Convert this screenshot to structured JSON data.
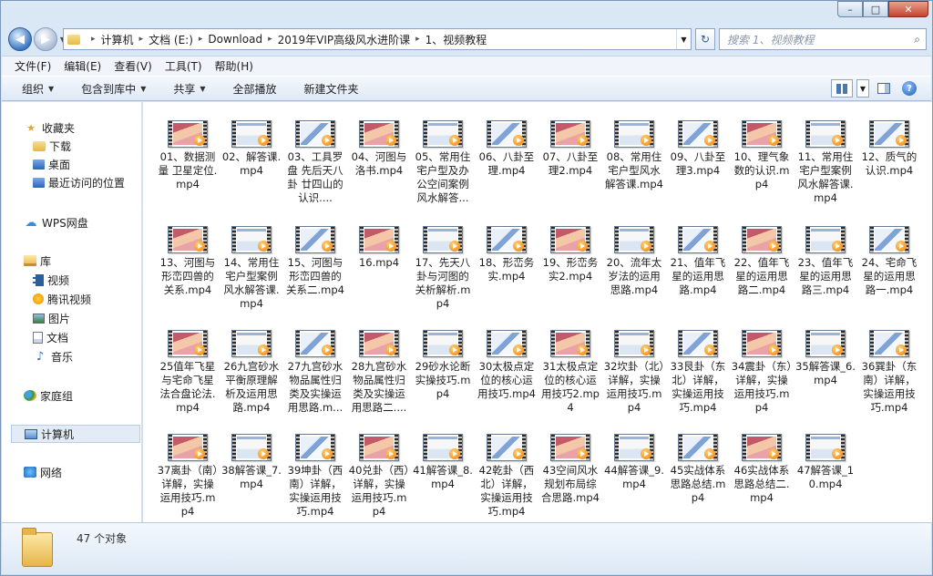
{
  "window": {
    "minimize_glyph": "–",
    "maximize_glyph": "□",
    "close_glyph": "✕"
  },
  "nav": {
    "back_glyph": "◀",
    "forward_glyph": "▶",
    "dropdown_glyph": "▼",
    "refresh_glyph": "↻"
  },
  "address": {
    "crumbs": [
      "计算机",
      "文档 (E:)",
      "Download",
      "2019年VIP高级风水进阶课",
      "1、视频教程"
    ],
    "separator": "▸"
  },
  "search": {
    "placeholder": "搜索 1、视频教程",
    "icon": "search-icon",
    "icon_glyph": "⌕"
  },
  "menu": {
    "items": [
      "文件(F)",
      "编辑(E)",
      "查看(V)",
      "工具(T)",
      "帮助(H)"
    ]
  },
  "toolbar": {
    "organize": "组织",
    "include_library": "包含到库中",
    "share": "共享",
    "play_all": "全部播放",
    "new_folder": "新建文件夹",
    "dropdown_glyph": "▼",
    "help_glyph": "?"
  },
  "sidebar": {
    "items": [
      {
        "label": "收藏夹",
        "icon": "star-icon",
        "glyph": "★"
      },
      {
        "label": "下载",
        "icon": "folder-icon",
        "glyph": ""
      },
      {
        "label": "桌面",
        "icon": "desktop-icon",
        "glyph": ""
      },
      {
        "label": "最近访问的位置",
        "icon": "recent-places-icon",
        "glyph": ""
      },
      {
        "label": "WPS网盘",
        "icon": "cloud-icon",
        "glyph": "☁"
      },
      {
        "label": "库",
        "icon": "library-icon",
        "glyph": ""
      },
      {
        "label": "视频",
        "icon": "video-library-icon",
        "glyph": ""
      },
      {
        "label": "腾讯视频",
        "icon": "tencent-video-icon",
        "glyph": ""
      },
      {
        "label": "图片",
        "icon": "pictures-icon",
        "glyph": ""
      },
      {
        "label": "文档",
        "icon": "documents-icon",
        "glyph": ""
      },
      {
        "label": "音乐",
        "icon": "music-icon",
        "glyph": "♪"
      },
      {
        "label": "家庭组",
        "icon": "homegroup-icon",
        "glyph": ""
      },
      {
        "label": "计算机",
        "icon": "computer-icon",
        "glyph": ""
      },
      {
        "label": "网络",
        "icon": "network-icon",
        "glyph": ""
      }
    ]
  },
  "files": [
    "01、数据测量 卫星定位.mp4",
    "02、解答课.mp4",
    "03、工具罗盘 先后天八卦 廿四山的认识....",
    "04、河图与洛书.mp4",
    "05、常用住宅户型及办公空间案例风水解答...",
    "06、八卦至理.mp4",
    "07、八卦至理2.mp4",
    "08、常用住宅户型风水解答课.mp4",
    "09、八卦至理3.mp4",
    "10、理气象数的认识.mp4",
    "11、常用住宅户型案例风水解答课.mp4",
    "12、质气的认识.mp4",
    "13、河图与形峦四兽的关系.mp4",
    "14、常用住宅户型案例风水解答课.mp4",
    "15、河图与形峦四兽的关系二.mp4",
    "16.mp4",
    "17、先天八卦与河图的关析解析.mp4",
    "18、形峦务实.mp4",
    "19、形峦务实2.mp4",
    "20、流年太岁法的运用思路.mp4",
    "21、值年飞星的运用思路.mp4",
    "22、值年飞星的运用思路二.mp4",
    "23、值年飞星的运用思路三.mp4",
    "24、宅命飞星的运用思路一.mp4",
    "25值年飞星与宅命飞星法合盘论法.mp4",
    "26九宫砂水平衡原理解析及运用思路.mp4",
    "27九宫砂水物品属性归类及实操运用思路.m...",
    "28九宫砂水物品属性归类及实操运用思路二....",
    "29砂水论断实操技巧.mp4",
    "30太极点定位的核心运用技巧.mp4",
    "31太极点定位的核心运用技巧2.mp4",
    "32坎卦（北）详解，实操运用技巧.mp4",
    "33艮卦（东北）详解，实操运用技巧.mp4",
    "34震卦（东）详解，实操运用技巧.mp4",
    "35解答课_6.mp4",
    "36巽卦（东南）详解，实操运用技巧.mp4",
    "37离卦（南）详解，实操运用技巧.mp4",
    "38解答课_7.mp4",
    "39坤卦（西南）详解，实操运用技巧.mp4",
    "40兑卦（西）详解，实操运用技巧.mp4",
    "41解答课_8.mp4",
    "42乾卦（西北）详解，实操运用技巧.mp4",
    "43空间风水规划布局综合思路.mp4",
    "44解答课_9.mp4",
    "45实战体系思路总结.mp4",
    "46实战体系思路总结二.mp4",
    "47解答课_10.mp4"
  ],
  "status": {
    "count": "47 个对象"
  }
}
